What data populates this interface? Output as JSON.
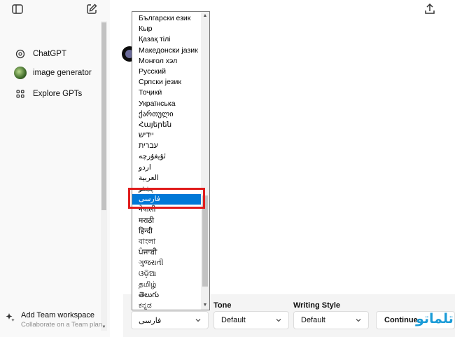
{
  "sidebar": {
    "items": [
      {
        "label": "ChatGPT",
        "icon": "openai-logo-icon"
      },
      {
        "label": "image generator",
        "icon": "gpt-avatar"
      },
      {
        "label": "Explore GPTs",
        "icon": "grid-icon"
      }
    ],
    "team": {
      "title": "Add Team workspace",
      "subtitle": "Collaborate on a Team plan"
    }
  },
  "dropdown": {
    "options": [
      "Български език",
      "Кыр",
      "Қазақ тілі",
      "Македонски јазик",
      "Монгол хэл",
      "Русский",
      "Српски језик",
      "Тоҷикӣ",
      "Українська",
      "ქართული",
      "Հայերեն",
      "ייִדיש",
      "עברית",
      "ئۇيغۇرچە",
      "اردو",
      "العربية",
      "پښتو",
      "فارسی",
      "नेपाली",
      "मराठी",
      "हिन्दी",
      "বাংলা",
      "ਪੰਜਾਬੀ",
      "ગુજરાતી",
      "ଓଡ଼ିଆ",
      "தமிழ்",
      "తెలుగు",
      "ಕನ್ನಡ"
    ],
    "selected_index": 17
  },
  "controls": {
    "language": {
      "value": "فارسی"
    },
    "tone": {
      "label": "Tone",
      "value": "Default"
    },
    "writing_style": {
      "label": "Writing Style",
      "value": "Default"
    },
    "continue_label": "Continue"
  },
  "watermark": "تلماتو",
  "colors": {
    "selection": "#0078d7",
    "highlight": "#e01c1c",
    "watermark": "#1a9bd7"
  }
}
